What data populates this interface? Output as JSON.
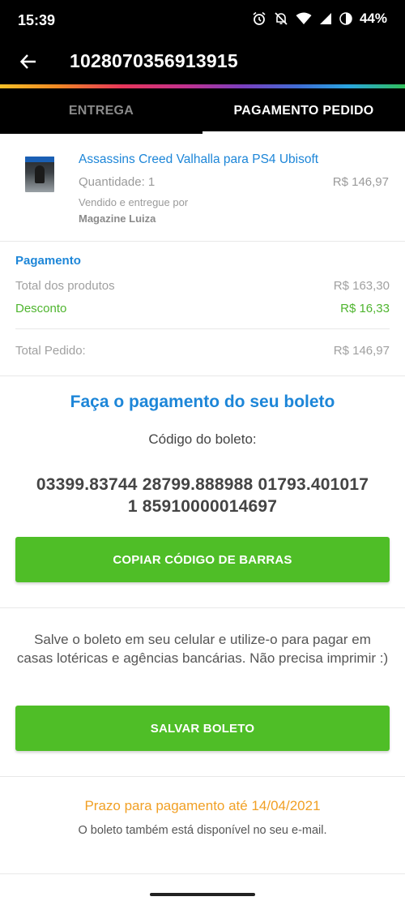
{
  "status_bar": {
    "time": "15:39",
    "battery": "44%",
    "icons": [
      "alarm-icon",
      "bell-off-icon",
      "wifi-icon",
      "signal-icon",
      "battery-icon"
    ]
  },
  "app_bar": {
    "back_icon": "arrow-left-icon",
    "order_id": "1028070356913915"
  },
  "tabs": [
    {
      "label": "ENTREGA",
      "active": false
    },
    {
      "label": "PAGAMENTO PEDIDO",
      "active": true
    }
  ],
  "product": {
    "title": "Assassins Creed Valhalla para PS4 Ubisoft",
    "quantity": "Quantidade: 1",
    "price": "R$ 146,97",
    "sold_by_label": "Vendido e entregue por",
    "seller": "Magazine Luiza"
  },
  "payment": {
    "title": "Pagamento",
    "rows": [
      {
        "label": "Total dos produtos",
        "value": "R$ 163,30"
      },
      {
        "label": "Desconto",
        "value": "R$ 16,33"
      },
      {
        "label": "Total Pedido:",
        "value": "R$ 146,97"
      }
    ]
  },
  "boleto": {
    "title": "Faça o pagamento do seu boleto",
    "code_label": "Código do boleto:",
    "code_line1": "03399.83744 28799.888988 01793.401017",
    "code_line2": "1 85910000014697",
    "copy_button": "COPIAR CÓDIGO DE BARRAS",
    "save_text": "Salve o boleto em seu celular e utilize-o para pagar em casas lotéricas e agências bancárias. Não precisa imprimir :)",
    "save_button": "SALVAR BOLETO",
    "deadline": "Prazo para pagamento até 14/04/2021",
    "email_note": "O boleto também está disponível no seu e-mail."
  },
  "colors": {
    "accent_blue": "#1d86d8",
    "discount_green": "#4fb52f",
    "button_green": "#4fbe27",
    "deadline_orange": "#f1a025"
  }
}
